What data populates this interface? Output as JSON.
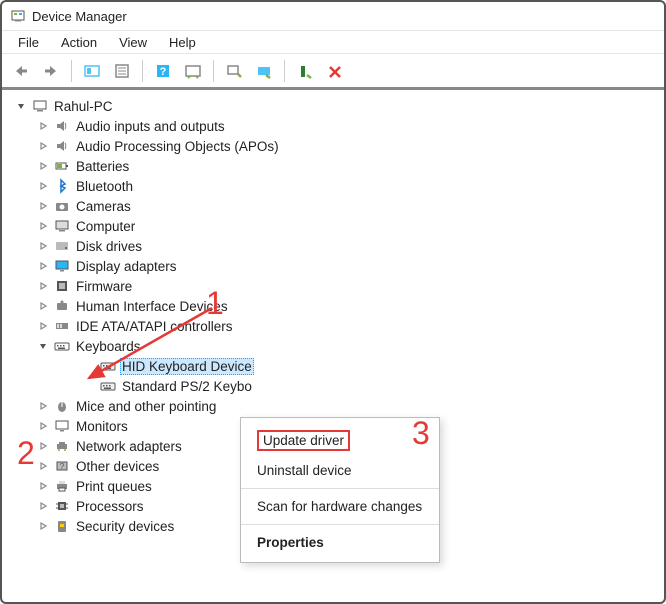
{
  "titlebar": {
    "title": "Device Manager"
  },
  "menubar": [
    "File",
    "Action",
    "View",
    "Help"
  ],
  "tree": {
    "root": "Rahul-PC",
    "categories": [
      {
        "label": "Audio inputs and outputs",
        "icon": "speaker"
      },
      {
        "label": "Audio Processing Objects (APOs)",
        "icon": "speaker"
      },
      {
        "label": "Batteries",
        "icon": "battery"
      },
      {
        "label": "Bluetooth",
        "icon": "bluetooth"
      },
      {
        "label": "Cameras",
        "icon": "camera"
      },
      {
        "label": "Computer",
        "icon": "computer"
      },
      {
        "label": "Disk drives",
        "icon": "disk"
      },
      {
        "label": "Display adapters",
        "icon": "display"
      },
      {
        "label": "Firmware",
        "icon": "firmware"
      },
      {
        "label": "Human Interface Devices",
        "icon": "hid"
      },
      {
        "label": "IDE ATA/ATAPI controllers",
        "icon": "ide"
      },
      {
        "label": "Keyboards",
        "icon": "keyboard",
        "expanded": true,
        "children": [
          {
            "label": "HID Keyboard Device",
            "icon": "keyboard-device",
            "selected": true
          },
          {
            "label": "Standard PS/2 Keybo",
            "icon": "keyboard-device"
          }
        ]
      },
      {
        "label": "Mice and other pointing",
        "icon": "mouse"
      },
      {
        "label": "Monitors",
        "icon": "monitor"
      },
      {
        "label": "Network adapters",
        "icon": "network"
      },
      {
        "label": "Other devices",
        "icon": "other"
      },
      {
        "label": "Print queues",
        "icon": "printer"
      },
      {
        "label": "Processors",
        "icon": "cpu"
      },
      {
        "label": "Security devices",
        "icon": "security"
      }
    ]
  },
  "context_menu": {
    "items": [
      {
        "label": "Update driver",
        "highlight": true
      },
      {
        "label": "Uninstall device"
      },
      {
        "sep": true
      },
      {
        "label": "Scan for hardware changes"
      },
      {
        "sep": true
      },
      {
        "label": "Properties",
        "bold": true
      }
    ]
  },
  "annotations": {
    "num1": "1",
    "num2": "2",
    "num3": "3"
  }
}
